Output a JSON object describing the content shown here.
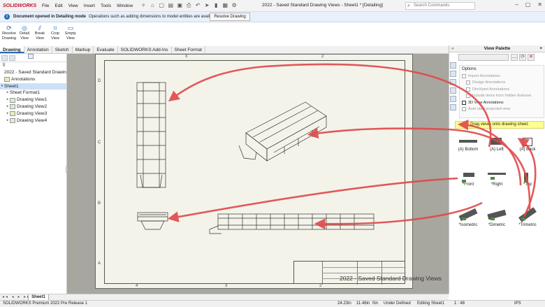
{
  "titlebar": {
    "logo": "SOLIDWORKS",
    "menus": [
      "File",
      "Edit",
      "View",
      "Insert",
      "Tools",
      "Window"
    ],
    "doc_title": "2022 - Saved Standard Drawing Views - Sheet1 * [Detailing]",
    "search_placeholder": "Search Commands"
  },
  "notification": {
    "bold": "Document opened in Detailing mode",
    "message": "Operations such as adding dimensions to model entities are available.",
    "button": "Resolve Drawing"
  },
  "commands": [
    {
      "l1": "Resolve",
      "l2": "Drawing"
    },
    {
      "l1": "Detail",
      "l2": "View"
    },
    {
      "l1": "Break",
      "l2": "View"
    },
    {
      "l1": "Crop",
      "l2": "View"
    },
    {
      "l1": "Empty",
      "l2": "View"
    }
  ],
  "tabs": [
    "Drawing",
    "Annotation",
    "Sketch",
    "Markup",
    "Evaluate",
    "SOLIDWORKS Add-Ins",
    "Sheet Format"
  ],
  "tree": {
    "root": "2022 - Saved Standard Drawin",
    "annotations": "Annotations",
    "sheet": "Sheet1",
    "children": [
      "Sheet Format1",
      "Drawing View1",
      "Drawing View2",
      "Drawing View3",
      "Drawing View4"
    ]
  },
  "sheet": {
    "zones_top": [
      "3",
      "2"
    ],
    "zones_bottom": [
      "4",
      "3",
      "2"
    ],
    "zones_left": [
      "D",
      "C",
      "B",
      "A"
    ],
    "watermark": "2022 - Saved Standard Drawing Views"
  },
  "view_palette": {
    "title": "View Palette",
    "options_title": "Options",
    "options": [
      {
        "label": "Import Annotations",
        "checked": false,
        "enabled": false,
        "indent": false
      },
      {
        "label": "Design Annotations",
        "checked": false,
        "enabled": false,
        "indent": true
      },
      {
        "label": "DimXpert Annotations",
        "checked": false,
        "enabled": false,
        "indent": true
      },
      {
        "label": "Include items from hidden features",
        "checked": false,
        "enabled": false,
        "indent": true
      },
      {
        "label": "3D View Annotations",
        "checked": false,
        "enabled": true,
        "indent": false
      },
      {
        "label": "Auto-start projected view",
        "checked": false,
        "enabled": false,
        "indent": false
      }
    ],
    "drag_hint": "Drag views onto drawing sheet.",
    "views": [
      "(A) Bottom",
      "(A) Left",
      "(A) Back",
      "*Front",
      "*Right",
      "*Top",
      "*Isometric",
      "*Dimetric",
      "*Trimetric"
    ]
  },
  "sheet_tab": "Sheet1",
  "status": {
    "app": "SOLIDWORKS Premium 2022 Pre Release 1",
    "x": "24.23in",
    "y": "11.48in",
    "z": "0in",
    "state": "Under Defined",
    "editing": "Editing Sheet1",
    "scale": "1 : 48",
    "units": "IPS"
  },
  "colors": {
    "brand": "#c8102e",
    "arrow": "#e04848",
    "accent": "#2a6ab8",
    "drag_hint_bg": "#ffff8c"
  }
}
